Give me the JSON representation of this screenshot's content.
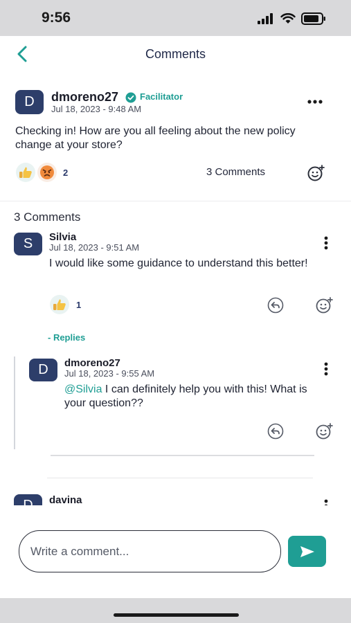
{
  "status_bar": {
    "time": "9:56"
  },
  "header": {
    "title": "Comments"
  },
  "post": {
    "avatar_letter": "D",
    "username": "dmoreno27",
    "role_badge": "Facilitator",
    "timestamp": "Jul 18, 2023 - 9:48 AM",
    "text": "Checking in! How are you all feeling about the new policy change at your store?",
    "reactions": [
      "thumbs-up",
      "angry-face"
    ],
    "reaction_count": "2",
    "comments_link": "3 Comments"
  },
  "comments_section": {
    "heading": "3 Comments",
    "comments": [
      {
        "avatar_letter": "S",
        "username": "Silvia",
        "timestamp": "Jul 18, 2023 - 9:51 AM",
        "text": "I would like some guidance to understand this better!",
        "reaction_count": "1",
        "replies_toggle": "- Replies",
        "replies": [
          {
            "avatar_letter": "D",
            "username": "dmoreno27",
            "timestamp": "Jul 18, 2023 - 9:55 AM",
            "mention": "@Silvia",
            "text": " I can definitely help you with this! What is your question??"
          }
        ]
      },
      {
        "avatar_letter": "D",
        "username": "davina"
      }
    ]
  },
  "composer": {
    "placeholder": "Write a comment..."
  },
  "colors": {
    "accent": "#1f9e94",
    "avatar": "#2d3e6a",
    "mention": "#1f9e94"
  }
}
